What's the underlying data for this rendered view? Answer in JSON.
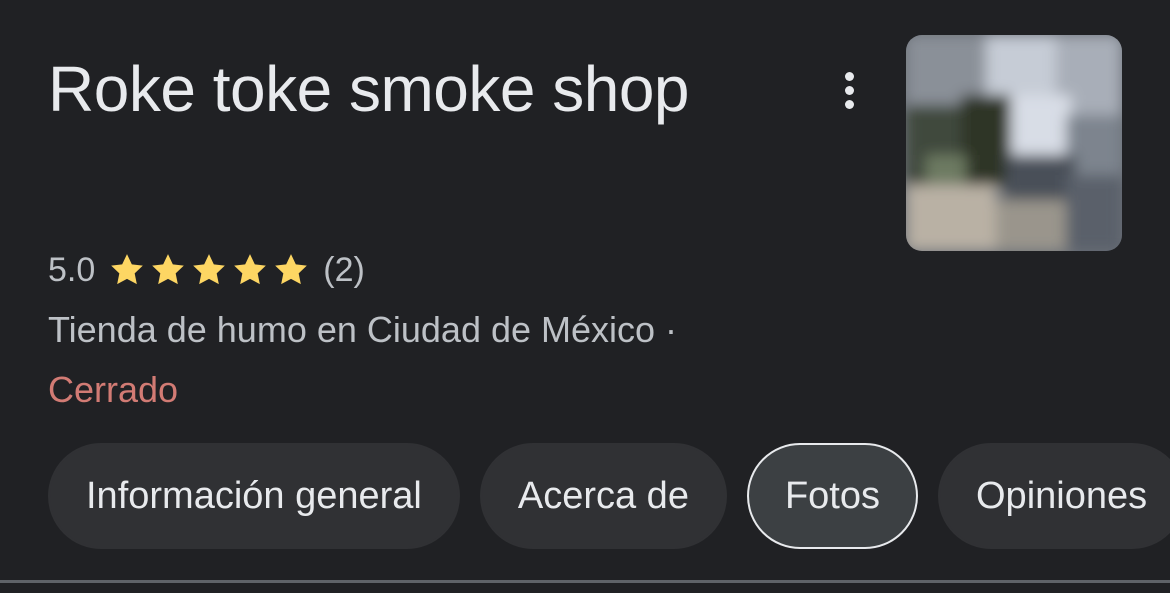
{
  "place": {
    "title": "Roke toke smoke shop",
    "rating": "5.0",
    "stars": 5,
    "review_count": "(2)",
    "category": "Tienda de humo en Ciudad de México ·",
    "status": "Cerrado"
  },
  "chips": [
    {
      "label": "Información general",
      "selected": false
    },
    {
      "label": "Acerca de",
      "selected": false
    },
    {
      "label": "Fotos",
      "selected": true
    },
    {
      "label": "Opiniones",
      "selected": false
    }
  ],
  "icons": {
    "more": "more-vert-icon",
    "star": "star-icon"
  },
  "colors": {
    "background": "#202124",
    "text_primary": "#e8eaed",
    "text_secondary": "#bdc1c6",
    "star": "#fdd663",
    "closed": "#f28b82"
  }
}
